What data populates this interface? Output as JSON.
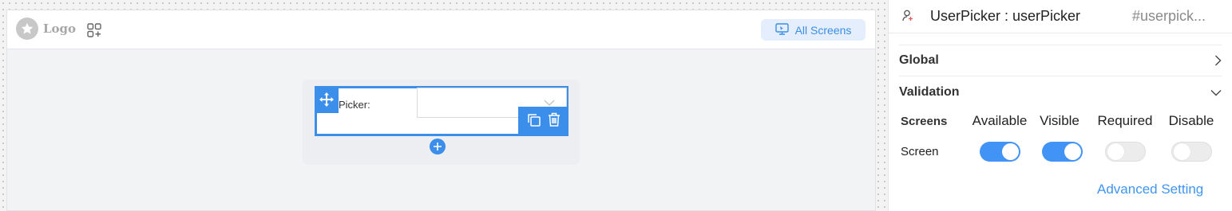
{
  "canvas": {
    "logo_text": "Logo",
    "all_screens_label": "All Screens"
  },
  "widget": {
    "label": "Picker:"
  },
  "panel": {
    "title": "UserPicker : userPicker",
    "id_text": "#userpick...",
    "sections": {
      "global": "Global",
      "validation": "Validation"
    },
    "validation": {
      "columns": [
        "Screens",
        "Available",
        "Visible",
        "Required",
        "Disable"
      ],
      "rows": [
        {
          "name": "Screen",
          "available": true,
          "visible": true,
          "required": false,
          "disable": false
        }
      ]
    },
    "advanced_link": "Advanced Setting"
  },
  "colors": {
    "accent": "#3b8eea",
    "toggle_on": "#4193f5",
    "link": "#3f95f2"
  }
}
